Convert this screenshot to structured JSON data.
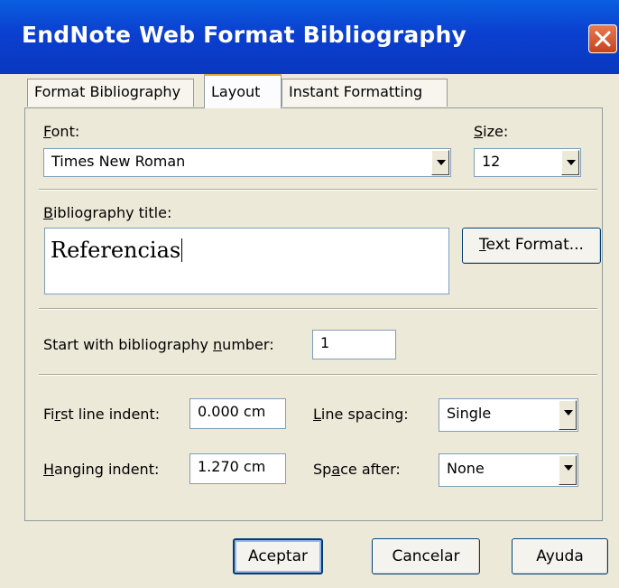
{
  "window": {
    "title": "EndNote Web Format Bibliography"
  },
  "tabs": [
    {
      "label": "Format Bibliography",
      "active": false
    },
    {
      "label": "Layout",
      "active": true
    },
    {
      "label": "Instant Formatting",
      "active": false
    }
  ],
  "font": {
    "label_accel": "F",
    "label_rest": "ont:",
    "value": "Times New Roman"
  },
  "size": {
    "label_accel": "S",
    "label_rest": "ize:",
    "value": "12"
  },
  "bib_title": {
    "label_accel": "B",
    "label_rest": "ibliography title:",
    "value": "Referencias"
  },
  "text_format_button": {
    "accel": "T",
    "rest": "ext Format..."
  },
  "start_number": {
    "label_pre": "Start with bibliography ",
    "label_accel": "n",
    "label_post": "umber:",
    "value": "1"
  },
  "first_line": {
    "label_pre": "Fi",
    "label_accel": "r",
    "label_post": "st line indent:",
    "value": "0.000 cm"
  },
  "hanging": {
    "label_accel": "H",
    "label_post": "anging indent:",
    "value": "1.270 cm"
  },
  "line_spacing": {
    "label_accel": "L",
    "label_post": "ine spacing:",
    "value": "Single"
  },
  "space_after": {
    "label_pre": "Sp",
    "label_accel": "a",
    "label_post": "ce after:",
    "value": "None"
  },
  "buttons": {
    "ok": "Aceptar",
    "cancel": "Cancelar",
    "help": "Ayuda"
  },
  "icons": {
    "close": "close-icon",
    "dropdown": "chevron-down-icon"
  },
  "colors": {
    "titlebar": "#0a4fd8",
    "active_tab_accent": "#e8a83a",
    "dialog_bg": "#ece9d8"
  }
}
